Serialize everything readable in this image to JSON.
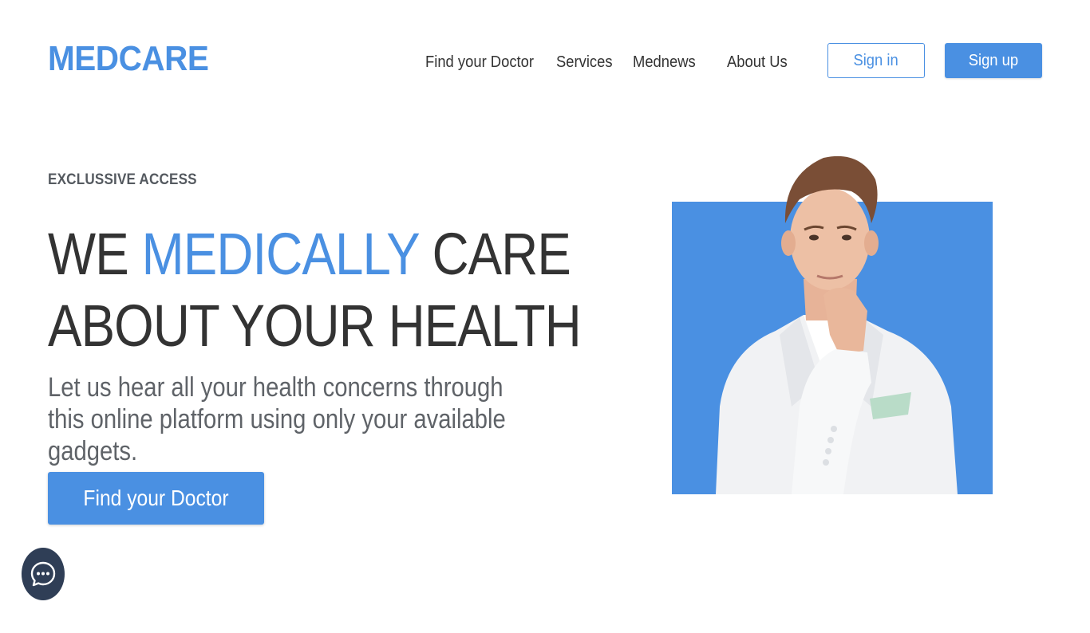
{
  "brand": {
    "logo": "MEDCARE",
    "accent_color": "#4a90e2"
  },
  "nav": {
    "items": [
      {
        "label": "Find your Doctor"
      },
      {
        "label": "Services"
      },
      {
        "label": "Mednews"
      },
      {
        "label": "About Us"
      }
    ],
    "signin_label": "Sign in",
    "signup_label": "Sign up"
  },
  "hero": {
    "eyebrow": "EXCLUSSIVE ACCESS",
    "headline_part1": "WE ",
    "headline_accent": "MEDICALLY",
    "headline_part2": " CARE",
    "headline_line2": "ABOUT YOUR HEALTH",
    "subtext": "Let us hear all your health concerns through this online platform using only your available gadgets.",
    "cta_label": "Find your Doctor"
  },
  "chat": {
    "icon": "chat-bubble-icon"
  }
}
